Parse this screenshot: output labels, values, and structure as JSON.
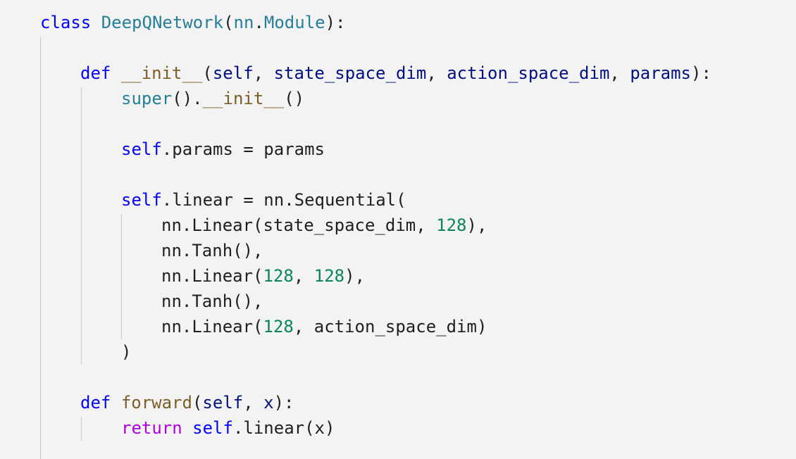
{
  "code": {
    "language": "python",
    "colors": {
      "background": "#f3f3f3",
      "keyword": "#0000ff",
      "class_name": "#267f99",
      "function": "#795e26",
      "parameter": "#001080",
      "number": "#098658",
      "control_flow": "#af00db",
      "plain": "#1f1f1f",
      "indent_guide": "#c8c8c8"
    },
    "lines": [
      [
        {
          "text": "class",
          "type": "kw"
        },
        {
          "text": " ",
          "type": "plain"
        },
        {
          "text": "DeepQNetwork",
          "type": "cls"
        },
        {
          "text": "(",
          "type": "plain"
        },
        {
          "text": "nn",
          "type": "cls"
        },
        {
          "text": ".",
          "type": "plain"
        },
        {
          "text": "Module",
          "type": "cls"
        },
        {
          "text": "):",
          "type": "plain"
        }
      ],
      [],
      [
        {
          "text": "def",
          "type": "kw"
        },
        {
          "text": " ",
          "type": "plain"
        },
        {
          "text": "__init__",
          "type": "fn"
        },
        {
          "text": "(",
          "type": "plain"
        },
        {
          "text": "self",
          "type": "param"
        },
        {
          "text": ", ",
          "type": "plain"
        },
        {
          "text": "state_space_dim",
          "type": "param"
        },
        {
          "text": ", ",
          "type": "plain"
        },
        {
          "text": "action_space_dim",
          "type": "param"
        },
        {
          "text": ", ",
          "type": "plain"
        },
        {
          "text": "params",
          "type": "param"
        },
        {
          "text": "):",
          "type": "plain"
        }
      ],
      [
        {
          "text": "super",
          "type": "cls"
        },
        {
          "text": "().",
          "type": "plain"
        },
        {
          "text": "__init__",
          "type": "fn"
        },
        {
          "text": "()",
          "type": "plain"
        }
      ],
      [],
      [
        {
          "text": "self",
          "type": "kw"
        },
        {
          "text": ".params = params",
          "type": "plain"
        }
      ],
      [],
      [
        {
          "text": "self",
          "type": "kw"
        },
        {
          "text": ".linear = nn.Sequential(",
          "type": "plain"
        }
      ],
      [
        {
          "text": "nn.Linear(state_space_dim, ",
          "type": "plain"
        },
        {
          "text": "128",
          "type": "num"
        },
        {
          "text": "),",
          "type": "plain"
        }
      ],
      [
        {
          "text": "nn.Tanh(),",
          "type": "plain"
        }
      ],
      [
        {
          "text": "nn.Linear(",
          "type": "plain"
        },
        {
          "text": "128",
          "type": "num"
        },
        {
          "text": ", ",
          "type": "plain"
        },
        {
          "text": "128",
          "type": "num"
        },
        {
          "text": "),",
          "type": "plain"
        }
      ],
      [
        {
          "text": "nn.Tanh(),",
          "type": "plain"
        }
      ],
      [
        {
          "text": "nn.Linear(",
          "type": "plain"
        },
        {
          "text": "128",
          "type": "num"
        },
        {
          "text": ", action_space_dim)",
          "type": "plain"
        }
      ],
      [
        {
          "text": ")",
          "type": "plain"
        }
      ],
      [],
      [
        {
          "text": "def",
          "type": "kw"
        },
        {
          "text": " ",
          "type": "plain"
        },
        {
          "text": "forward",
          "type": "fn"
        },
        {
          "text": "(",
          "type": "plain"
        },
        {
          "text": "self",
          "type": "param"
        },
        {
          "text": ", ",
          "type": "plain"
        },
        {
          "text": "x",
          "type": "param"
        },
        {
          "text": "):",
          "type": "plain"
        }
      ],
      [
        {
          "text": "return",
          "type": "flow"
        },
        {
          "text": " ",
          "type": "plain"
        },
        {
          "text": "self",
          "type": "kw"
        },
        {
          "text": ".linear(x)",
          "type": "plain"
        }
      ]
    ]
  }
}
